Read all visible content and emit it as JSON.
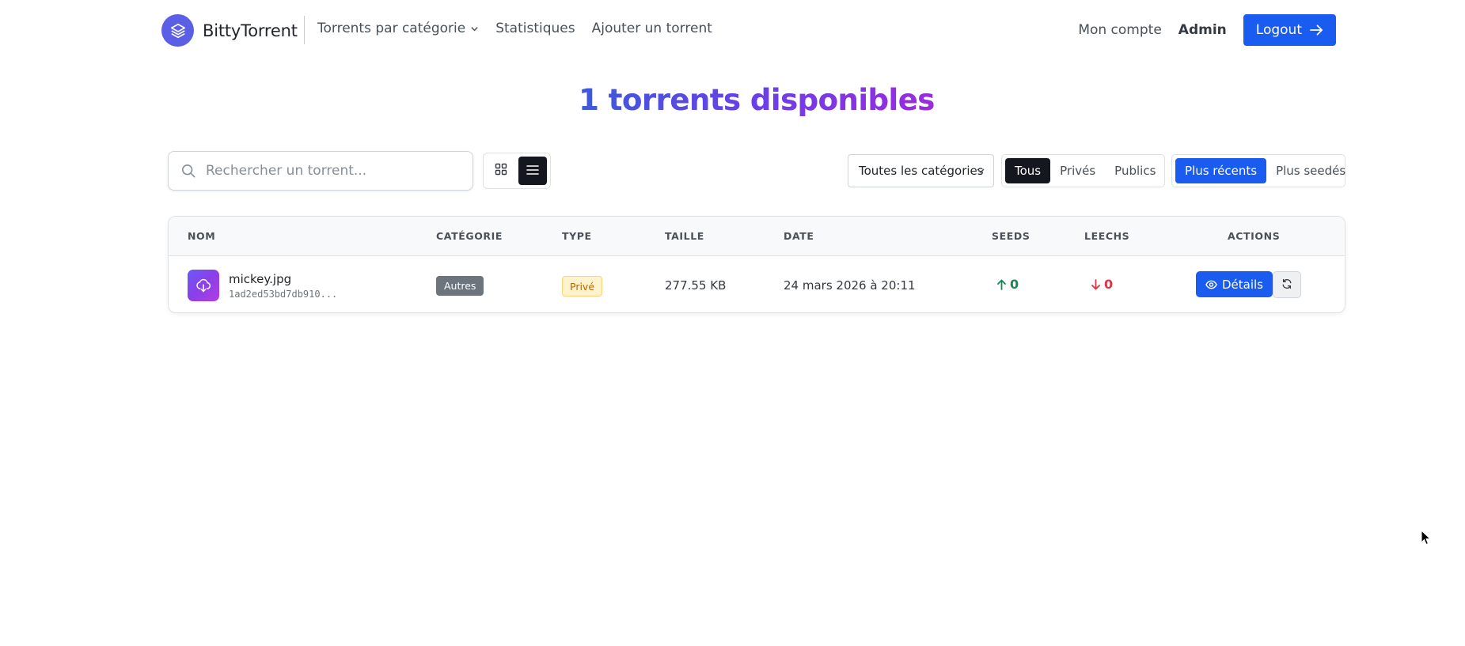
{
  "navbar": {
    "brand_name": "BittyTorrent",
    "links": [
      {
        "label": "Torrents par catégorie",
        "has_dropdown": true
      },
      {
        "label": "Statistiques"
      },
      {
        "label": "Ajouter un torrent"
      }
    ],
    "account_label": "Mon compte",
    "admin_label": "Admin",
    "logout_label": "Logout",
    "accent_color": "#1a5cf0"
  },
  "page": {
    "title": "1 torrents disponibles"
  },
  "toolbar": {
    "search_placeholder": "Rechercher un torrent...",
    "search_value": "",
    "view_mode": "list",
    "category_select": "Toutes les catégories",
    "type_filter": {
      "options": [
        "Tous",
        "Privés",
        "Publics"
      ],
      "active": "Tous"
    },
    "sort": {
      "options": [
        "Plus récents",
        "Plus seedés"
      ],
      "active": "Plus récents"
    }
  },
  "table": {
    "headers": {
      "name": "NOM",
      "category": "CATÉGORIE",
      "type": "TYPE",
      "size": "TAILLE",
      "date": "DATE",
      "seeds": "SEEDS",
      "leechs": "LEECHS",
      "actions": "ACTIONS"
    },
    "rows": [
      {
        "name": "mickey.jpg",
        "hash": "1ad2ed53bd7db910...",
        "category": "Autres",
        "type": "Privé",
        "size": "277.55 KB",
        "date": "24 mars 2026 à 20:11",
        "seeds": "0",
        "leechs": "0",
        "details_label": "Détails"
      }
    ]
  },
  "colors": {
    "seeds": "#198754",
    "leechs": "#dc3545",
    "dark_button": "#14171f"
  }
}
